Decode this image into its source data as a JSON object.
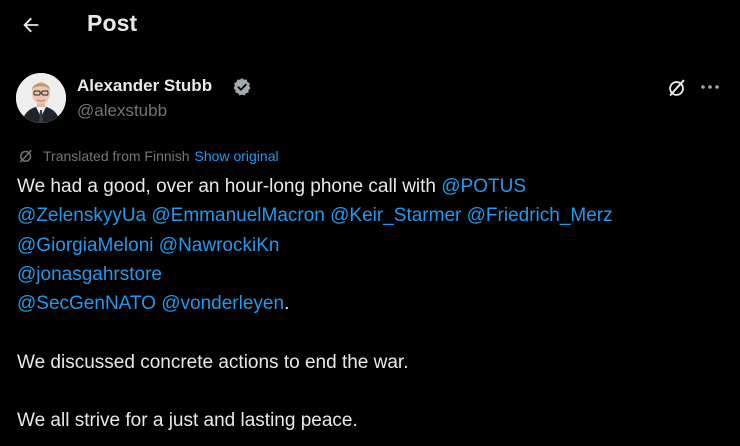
{
  "header": {
    "back_icon": "arrow-left-icon",
    "title": "Post"
  },
  "author": {
    "name": "Alexander Stubb",
    "handle": "@alexstubb",
    "verified_icon": "verified-badge-icon",
    "verified_color": "#1d9bf0"
  },
  "actions": {
    "grok_icon": "grok-icon",
    "more_icon": "more-horizontal-icon"
  },
  "translation": {
    "icon": "translate-icon",
    "text": "Translated from Finnish",
    "link": "Show original"
  },
  "post": {
    "line1_text": "We had a good, over an hour-long phone call with ",
    "mentions": [
      "@POTUS",
      "@ZelenskyyUa",
      "@EmmanuelMacron",
      "@Keir_Starmer",
      "@Friedrich_Merz",
      "@GiorgiaMeloni",
      "@NawrockiKn",
      "@jonasgahrstore",
      "@SecGenNATO",
      "@vonderleyen"
    ],
    "period": ".",
    "paragraph2": "We discussed concrete actions to end the war.",
    "paragraph3": "We all strive for a just and lasting peace."
  },
  "colors": {
    "background": "#000000",
    "text": "#e7e9ea",
    "secondary": "#71767b",
    "link": "#1d9bf0"
  }
}
